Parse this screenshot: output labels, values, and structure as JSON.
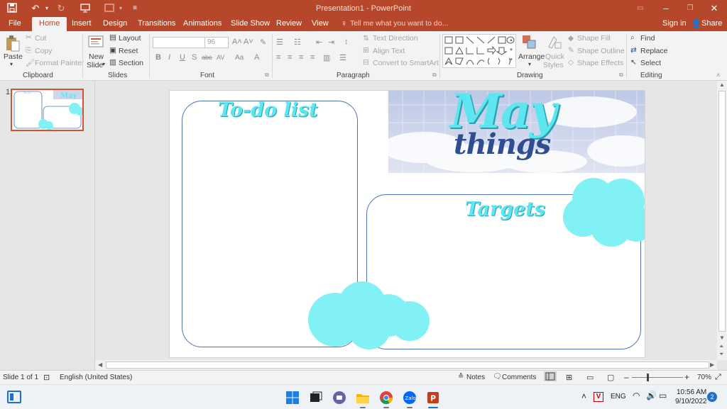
{
  "window": {
    "title": "Presentation1 - PowerPoint",
    "signin_label": "Sign in",
    "share_label": "Share"
  },
  "tabs": [
    "File",
    "Home",
    "Insert",
    "Design",
    "Transitions",
    "Animations",
    "Slide Show",
    "Review",
    "View"
  ],
  "tell_me_placeholder": "Tell me what you want to do...",
  "ribbon": {
    "clipboard": {
      "paste": "Paste",
      "cut": "Cut",
      "copy": "Copy",
      "format_painter": "Format Painter",
      "group": "Clipboard"
    },
    "slides": {
      "new_slide_line1": "New",
      "new_slide_line2": "Slide",
      "layout": "Layout",
      "reset": "Reset",
      "section": "Section",
      "group": "Slides"
    },
    "font": {
      "font_name": "",
      "font_size": "96",
      "bold": "B",
      "italic": "I",
      "underline": "U",
      "strike": "S",
      "abc": "abc",
      "av": "AV",
      "aa": "Aa",
      "group": "Font"
    },
    "paragraph": {
      "text_direction": "Text Direction",
      "align_text": "Align Text",
      "convert_smartart": "Convert to SmartArt",
      "group": "Paragraph"
    },
    "drawing": {
      "arrange": "Arrange",
      "quick_styles_line1": "Quick",
      "quick_styles_line2": "Styles",
      "shape_fill": "Shape Fill",
      "shape_outline": "Shape Outline",
      "shape_effects": "Shape Effects",
      "group": "Drawing"
    },
    "editing": {
      "find": "Find",
      "replace": "Replace",
      "select": "Select",
      "group": "Editing"
    }
  },
  "thumbnail": {
    "number": "1"
  },
  "slide": {
    "todo_title": "To-do list",
    "targets_title": "Targets",
    "may_text": "May",
    "things_text": "things",
    "accent_color": "#5ee6f0",
    "cloud_color": "#82f1f6",
    "border_color": "#4f73b8"
  },
  "status": {
    "slide_counter": "Slide 1 of 1",
    "language": "English (United States)",
    "notes": "Notes",
    "comments": "Comments",
    "zoom": "70%"
  },
  "taskbar": {
    "language": "ENG",
    "time": "10:56 AM",
    "date": "9/10/2022",
    "notif_count": "2"
  }
}
